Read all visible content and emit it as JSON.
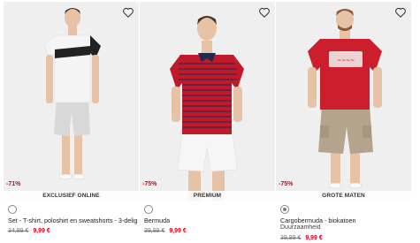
{
  "products": [
    {
      "discount": "-71%",
      "ribbon": "EXCLUSIEF ONLINE",
      "title": "Set - T-shirt, poloshirt en sweatshorts - 3-delig",
      "subtitle": "",
      "old_price": "34,99 €",
      "new_price": "9,99 €",
      "swatch_color": "#ffffff",
      "shirt_color": "#f4f4f4",
      "shorts_color": "#d8d8d8"
    },
    {
      "discount": "-75%",
      "ribbon": "PREMIUM",
      "title": "Bermuda",
      "subtitle": "",
      "old_price": "39,99 €",
      "new_price": "9,99 €",
      "swatch_color": "#ffffff",
      "shirt_color": "#c0192a",
      "shorts_color": "#f6f6f6"
    },
    {
      "discount": "-75%",
      "ribbon": "GROTE MATEN",
      "title": "Cargobermuda - biokatoen",
      "subtitle": "Duurzaamheid",
      "old_price": "39,99 €",
      "new_price": "9,99 €",
      "swatch_color": "#8a7a6e",
      "shirt_color": "#cc1f2e",
      "shorts_color": "#b5a48d"
    }
  ],
  "colors": {
    "sale_red": "#d5001c",
    "background": "#ffffff",
    "photo_bg": "#efefef"
  },
  "icons": {
    "wishlist": "heart-icon"
  }
}
